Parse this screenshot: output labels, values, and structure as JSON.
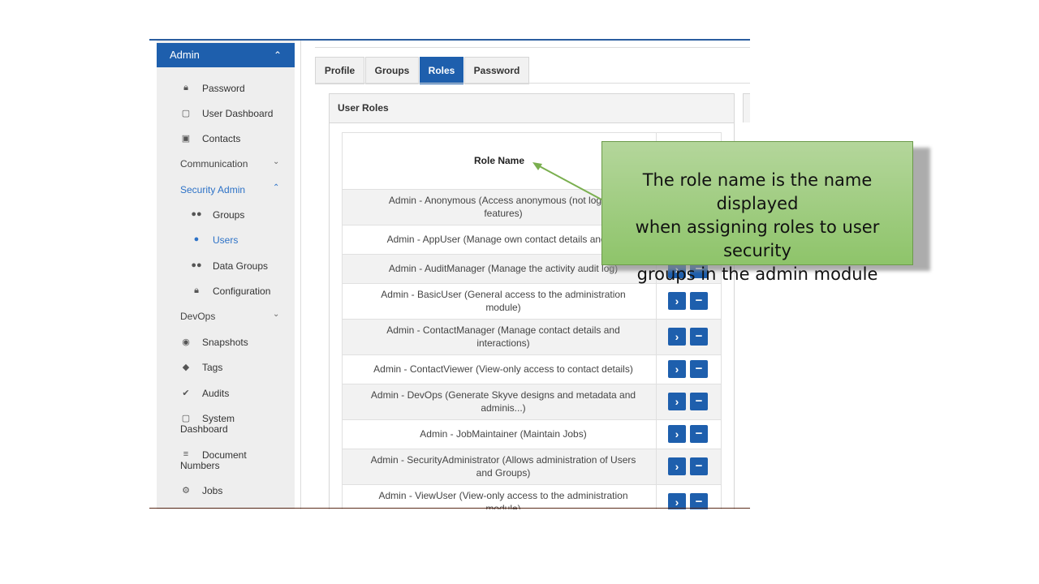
{
  "sidebar": {
    "header": "Admin",
    "items": [
      {
        "label": "Password",
        "icon": "lock-icon"
      },
      {
        "label": "User Dashboard",
        "icon": "area-chart-icon"
      },
      {
        "label": "Contacts",
        "icon": "address-card-icon"
      }
    ],
    "communication": "Communication",
    "security_admin": "Security Admin",
    "security_items": [
      {
        "label": "Groups",
        "icon": "users-icon"
      },
      {
        "label": "Users",
        "icon": "user-icon"
      },
      {
        "label": "Data Groups",
        "icon": "users-icon"
      },
      {
        "label": "Configuration",
        "icon": "lock-icon"
      }
    ],
    "devops": "DevOps",
    "devops_items": [
      {
        "label": "Snapshots",
        "icon": "camera-icon"
      },
      {
        "label": "Tags",
        "icon": "tag-icon"
      },
      {
        "label": "Audits",
        "icon": "check-icon"
      },
      {
        "label_line1": "System",
        "label_line2": "Dashboard",
        "icon": "area-chart-icon"
      },
      {
        "label_line1": "Document",
        "label_line2": "Numbers",
        "icon": "list-ol-icon"
      },
      {
        "label": "Jobs",
        "icon": "cogs-icon"
      }
    ]
  },
  "tabs": [
    "Profile",
    "Groups",
    "Roles",
    "Password"
  ],
  "active_tab": "Roles",
  "panel": {
    "title": "User Roles",
    "column_header": "Role Name",
    "rows": [
      {
        "line1": "Admin - Anonymous (Access anonymous (not logged",
        "line2": "features)"
      },
      {
        "line1": "Admin - AppUser (Manage own contact details and pa",
        "line2": ""
      },
      {
        "line1": "Admin - AuditManager (Manage the activity audit log)",
        "line2": ""
      },
      {
        "line1": "Admin - BasicUser (General access to the administration",
        "line2": "module)"
      },
      {
        "line1": "Admin - ContactManager (Manage contact details and",
        "line2": "interactions)"
      },
      {
        "line1": "Admin - ContactViewer (View-only access to contact details)",
        "line2": ""
      },
      {
        "line1": "Admin - DevOps (Generate Skyve designs and metadata and",
        "line2": "adminis...)"
      },
      {
        "line1": "Admin - JobMaintainer (Maintain Jobs)",
        "line2": ""
      },
      {
        "line1": "Admin - SecurityAdministrator (Allows administration of Users",
        "line2": "and Groups)"
      },
      {
        "line1": "Admin - ViewUser (View-only access to the administration",
        "line2": "module)"
      }
    ],
    "go_glyph": "›",
    "remove_glyph": "−"
  },
  "callout": {
    "line1": "The role name is the name displayed",
    "line2": "when assigning roles to user security",
    "line3": "groups in the admin module"
  },
  "colors": {
    "accent": "#1e5fad",
    "link": "#2d72c7",
    "callout": "#9ccc7c"
  }
}
